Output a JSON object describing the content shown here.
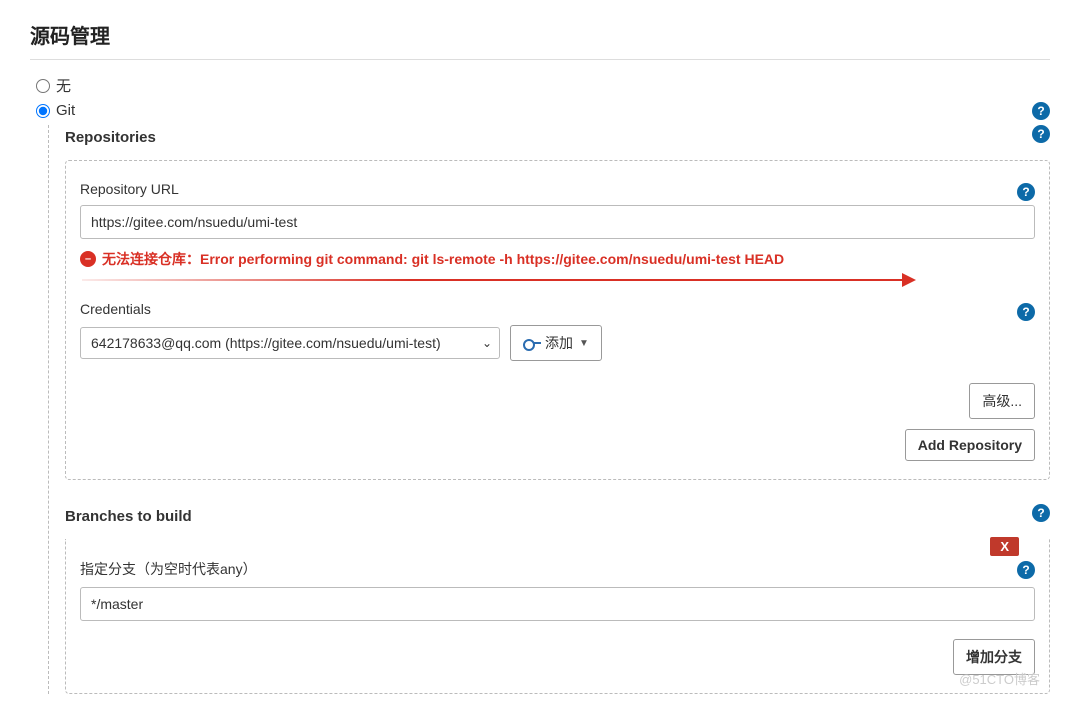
{
  "title": "源码管理",
  "scm": {
    "none_label": "无",
    "git_label": "Git"
  },
  "repositories": {
    "label": "Repositories",
    "url_label": "Repository URL",
    "url_value": "https://gitee.com/nsuedu/umi-test",
    "error_text": "无法连接仓库：Error performing git command: git ls-remote -h https://gitee.com/nsuedu/umi-test HEAD",
    "credentials_label": "Credentials",
    "credentials_selected": "642178633@qq.com (https://gitee.com/nsuedu/umi-test)",
    "add_button": "添加",
    "advanced_button": "高级...",
    "add_repo_button": "Add Repository"
  },
  "branches": {
    "label": "Branches to build",
    "spec_label": "指定分支（为空时代表any）",
    "spec_value": "*/master",
    "delete_label": "X",
    "add_branch_button": "增加分支"
  },
  "watermark": "@51CTO博客"
}
